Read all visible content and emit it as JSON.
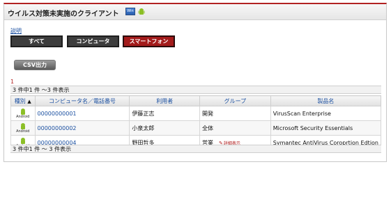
{
  "header": {
    "title": "ウイルス対策未実施のクライアント",
    "win_label": "Win"
  },
  "help": {
    "label": "説明"
  },
  "filters": [
    {
      "label": "すべて"
    },
    {
      "label": "コンピュータ"
    },
    {
      "label": "スマートフォン"
    }
  ],
  "csv_button": {
    "label": "CSV出力"
  },
  "pagination": {
    "current_page": "1",
    "summary_top": "3 件中1 件 ～3 件表示",
    "summary_bottom": "3 件中1 件 ～ 3 件表示"
  },
  "table": {
    "columns": [
      {
        "label": "種別"
      },
      {
        "label": "コンピュータ名／電話番号"
      },
      {
        "label": "利用者"
      },
      {
        "label": "グループ"
      },
      {
        "label": "製品名"
      }
    ],
    "sort_indicator": "▲",
    "rows": [
      {
        "type": "Android",
        "name": "00000000001",
        "user": "伊藤正志",
        "group": "開発",
        "detail": "",
        "product": "VirusScan Enterprise"
      },
      {
        "type": "Android",
        "name": "00000000002",
        "user": "小泉太郎",
        "group": "全体",
        "detail": "",
        "product": "Microsoft Security Essentials"
      },
      {
        "type": "Android",
        "name": "00000000004",
        "user": "野田哲多",
        "group": "営業",
        "detail": "詳細表示",
        "product": "Symantec AntiVirus Coroprtion Edtion"
      }
    ]
  },
  "colors": {
    "accent_red": "#b22222",
    "link_blue": "#1a4fa0",
    "android_green": "#8cbf26"
  },
  "icons": {
    "windows": "windows-icon",
    "android": "android-icon",
    "pencil": "pencil-icon"
  }
}
